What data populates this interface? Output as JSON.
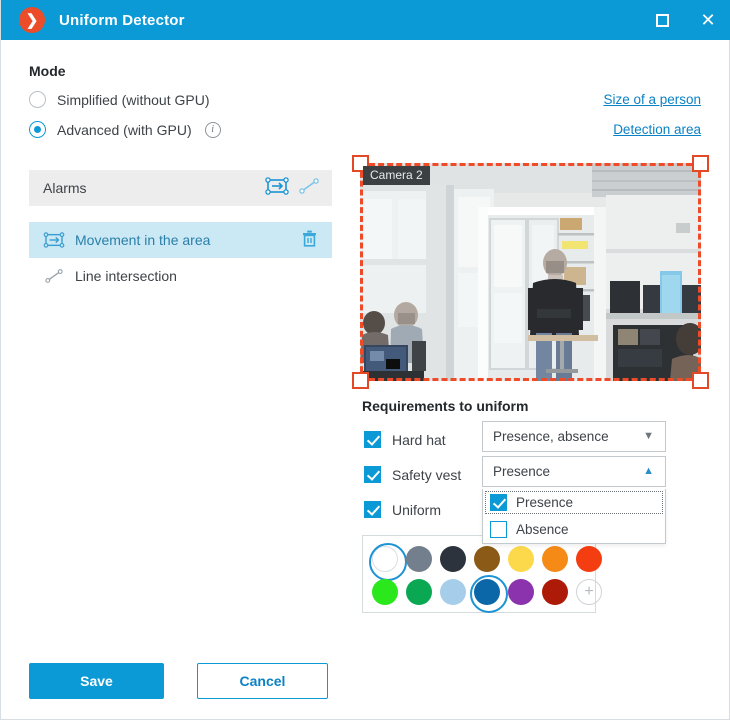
{
  "window": {
    "title": "Uniform Detector",
    "logo_icon": "chevron-right-logo",
    "maximize_icon": "maximize-icon",
    "close_icon": "close-icon",
    "accent_color": "#0c9ad6",
    "logo_color": "#eb4d2a"
  },
  "mode": {
    "title": "Mode",
    "options": [
      {
        "label": "Simplified (without GPU)",
        "selected": false
      },
      {
        "label": "Advanced (with GPU)",
        "selected": true,
        "info_icon": "info-icon"
      }
    ]
  },
  "links": [
    {
      "label": "Size of a person"
    },
    {
      "label": "Detection area"
    }
  ],
  "alarms": {
    "header_label": "Alarms",
    "header_icons": [
      "area-movement-icon",
      "line-intersection-icon"
    ],
    "items": [
      {
        "label": "Movement in the area",
        "icon": "area-movement-icon",
        "selected": true,
        "delete_icon": "trash-icon"
      },
      {
        "label": "Line intersection",
        "icon": "line-intersection-icon",
        "selected": false
      }
    ]
  },
  "camera": {
    "label": "Camera 2",
    "detection_border_color": "#ef4b28",
    "handle_icon": "resize-handle"
  },
  "requirements": {
    "title": "Requirements to uniform",
    "items": [
      {
        "label": "Hard hat",
        "checked": true,
        "value": "Presence, absence",
        "open": false
      },
      {
        "label": "Safety vest",
        "checked": true,
        "value": "Presence",
        "open": true
      },
      {
        "label": "Uniform",
        "checked": true
      }
    ],
    "dropdown": {
      "options": [
        {
          "label": "Presence",
          "checked": true,
          "focused": true
        },
        {
          "label": "Absence",
          "checked": false,
          "focused": false
        }
      ]
    },
    "caret_down_icon": "chevron-down-icon",
    "caret_up_icon": "chevron-up-icon"
  },
  "palette": {
    "add_label": "+",
    "rows": [
      [
        {
          "color": "#ffffff",
          "selected": true
        },
        {
          "color": "#737f8c",
          "selected": false
        },
        {
          "color": "#2d333d",
          "selected": false
        },
        {
          "color": "#8a5a16",
          "selected": false
        },
        {
          "color": "#fbd94b",
          "selected": false
        },
        {
          "color": "#f68a17",
          "selected": false
        },
        {
          "color": "#f53d12",
          "selected": false
        }
      ],
      [
        {
          "color": "#2ae81b",
          "selected": false
        },
        {
          "color": "#0aa852",
          "selected": false
        },
        {
          "color": "#a6ceeb",
          "selected": false
        },
        {
          "color": "#0b67a8",
          "selected": true
        },
        {
          "color": "#8a33ac",
          "selected": false
        },
        {
          "color": "#ae1a08",
          "selected": false
        }
      ]
    ]
  },
  "footer": {
    "save_label": "Save",
    "cancel_label": "Cancel"
  }
}
